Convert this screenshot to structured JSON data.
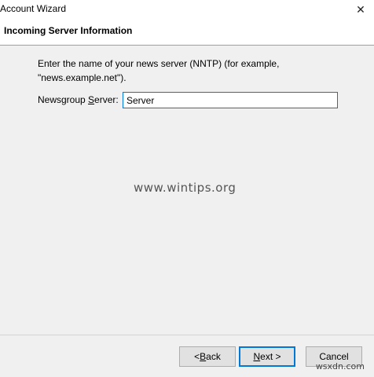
{
  "window": {
    "title": "Account Wizard",
    "close_glyph": "✕"
  },
  "header": {
    "title": "Incoming Server Information"
  },
  "form": {
    "instructions_line1": "Enter the name of your news server (NNTP) (for example,",
    "instructions_line2": "\"news.example.net\").",
    "server_label_pre": "Newsgroup ",
    "server_label_mnemonic": "S",
    "server_label_post": "erver:",
    "server_value": "Server"
  },
  "watermark": "www.wintips.org",
  "buttons": {
    "back_prefix": "< ",
    "back_mnemonic": "B",
    "back_suffix": "ack",
    "next_mnemonic": "N",
    "next_suffix": "ext >",
    "cancel_label": "Cancel"
  },
  "corner_mark": "wsxdn.com",
  "colors": {
    "focus_border": "#0078d7",
    "dialog_bg": "#f0f0f0",
    "header_bg": "#ffffff"
  }
}
